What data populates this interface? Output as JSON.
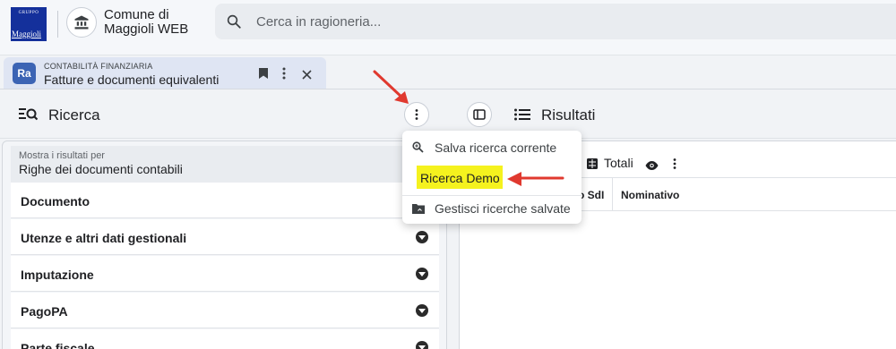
{
  "header": {
    "logo_top": "GRUPPO",
    "logo_text": "Maggioli",
    "app_name": "Comune di Maggioli WEB",
    "search_placeholder": "Cerca in ragioneria..."
  },
  "tab": {
    "badge": "Ra",
    "category": "CONTABILITÀ FINANZIARIA",
    "title": "Fatture e documenti equivalenti"
  },
  "search_pane": {
    "title": "Ricerca",
    "select_label": "Mostra i risultati per",
    "select_value": "Righe dei documenti contabili",
    "sections": [
      {
        "label": "Documento"
      },
      {
        "label": "Utenze e altri dati gestionali"
      },
      {
        "label": "Imputazione"
      },
      {
        "label": "PagoPA"
      },
      {
        "label": "Parte fiscale"
      }
    ]
  },
  "results_pane": {
    "title": "Risultati",
    "totals_label": "Totali",
    "columns": [
      "o SdI",
      "Nominativo"
    ]
  },
  "context_menu": {
    "items": [
      {
        "label": "Salva ricerca corrente",
        "icon": "zoom-in-icon"
      },
      {
        "label": "Ricerca Demo",
        "highlighted": true
      },
      {
        "label": "Gestisci ricerche salvate",
        "icon": "folder-icon"
      }
    ]
  },
  "colors": {
    "accent": "#3c64b4",
    "highlight": "#f5f21e",
    "annotation_arrow": "#e0392f",
    "logo_bg": "#14309b"
  }
}
